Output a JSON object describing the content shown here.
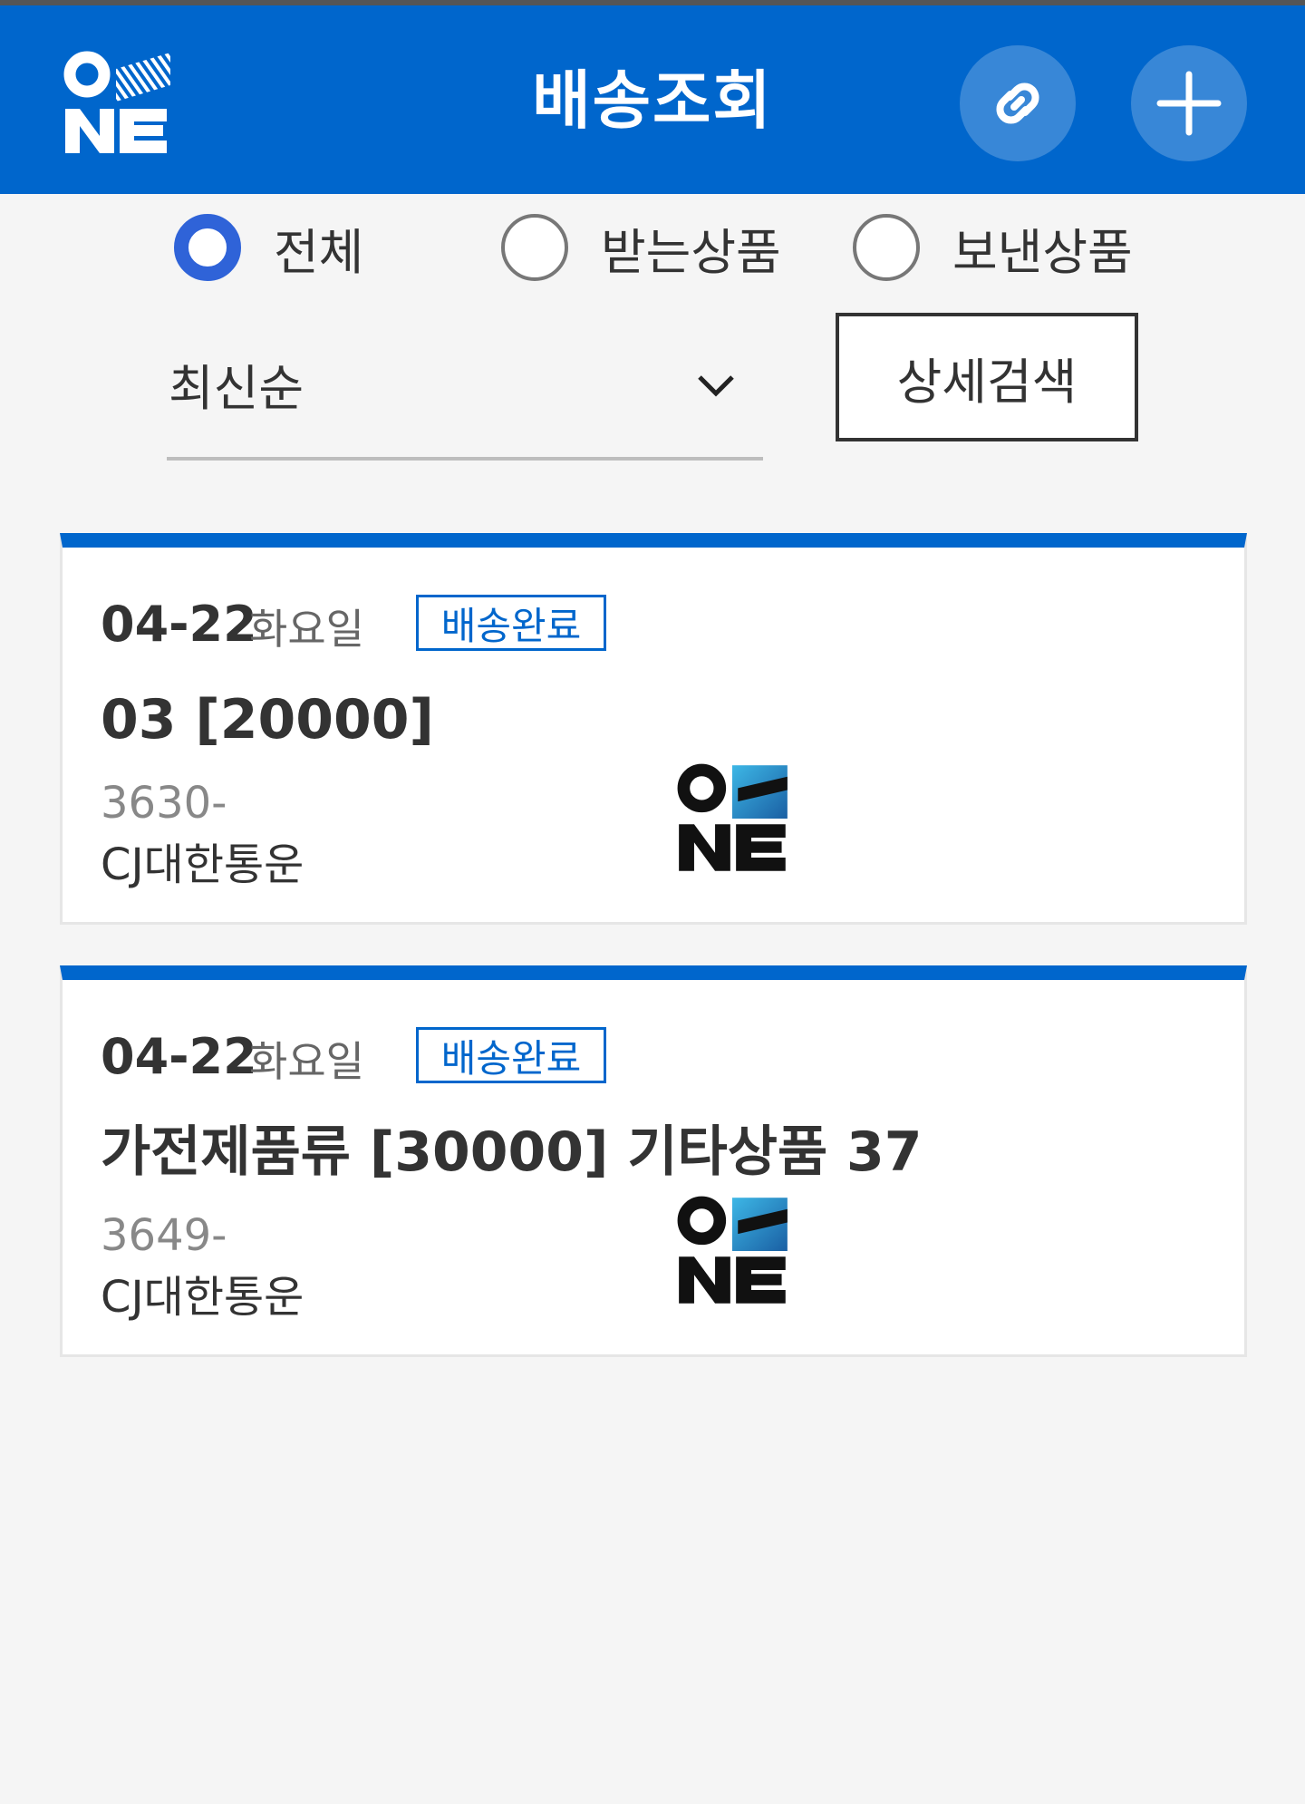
{
  "header": {
    "title": "배송조회",
    "logo_icon": "one-logo-icon",
    "link_icon": "link-icon",
    "add_icon": "plus-icon",
    "bg_color": "#0066cc"
  },
  "filter": {
    "options": [
      {
        "label": "전체",
        "checked": true
      },
      {
        "label": "받는상품",
        "checked": false
      },
      {
        "label": "보낸상품",
        "checked": false
      }
    ]
  },
  "sort": {
    "selected": "최신순"
  },
  "detail_search_label": "상세검색",
  "shipments": [
    {
      "date": "04-22",
      "weekday": "화요일",
      "status": "배송완료",
      "product": "03 [20000]",
      "tracking_no": "3630-",
      "carrier": "CJ대한통운"
    },
    {
      "date": "04-22",
      "weekday": "화요일",
      "status": "배송완료",
      "product": "가전제품류 [30000] 기타상품 37",
      "tracking_no": "3649-",
      "carrier": "CJ대한통운"
    }
  ]
}
